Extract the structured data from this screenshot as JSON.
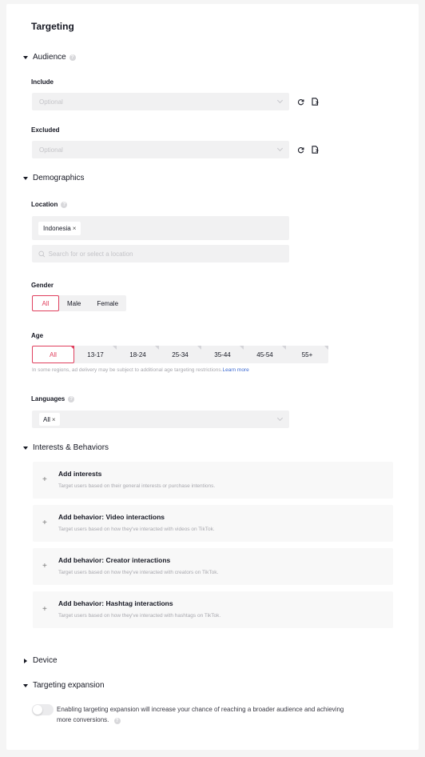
{
  "page": {
    "title": "Targeting"
  },
  "colors": {
    "accent": "#e0405e",
    "link": "#3e6bd1",
    "field_bg": "#f1f1f2"
  },
  "audience": {
    "section_label": "Audience",
    "expanded": true,
    "include": {
      "label": "Include",
      "placeholder": "Optional",
      "actions": [
        "refresh-icon",
        "file-import-icon"
      ]
    },
    "excluded": {
      "label": "Excluded",
      "placeholder": "Optional",
      "actions": [
        "refresh-icon",
        "file-import-icon"
      ]
    }
  },
  "demographics": {
    "section_label": "Demographics",
    "expanded": true,
    "location": {
      "label": "Location",
      "selected": [
        "Indonesia"
      ],
      "remove_glyph": "×",
      "search_placeholder": "Search for or select a location"
    },
    "gender": {
      "label": "Gender",
      "options": [
        "All",
        "Male",
        "Female"
      ],
      "selected": "All"
    },
    "age": {
      "label": "Age",
      "options": [
        "All",
        "13-17",
        "18-24",
        "25-34",
        "35-44",
        "45-54",
        "55+"
      ],
      "selected": "All",
      "hint": "In some regions, ad delivery may be subject to additional age targeting restrictions.",
      "hint_link": "Learn more"
    },
    "languages": {
      "label": "Languages",
      "selected": [
        "All"
      ],
      "remove_glyph": "×"
    }
  },
  "interests_behaviors": {
    "section_label": "Interests & Behaviors",
    "expanded": true,
    "cards": [
      {
        "title": "Add interests",
        "description": "Target users based on their general interests or purchase intentions."
      },
      {
        "title": "Add behavior: Video interactions",
        "description": "Target users based on how they've interacted with videos on TikTok."
      },
      {
        "title": "Add behavior: Creator interactions",
        "description": "Target users based on how they've interacted with creators on TikTok."
      },
      {
        "title": "Add behavior: Hashtag interactions",
        "description": "Target users based on how they've interacted with hashtags on TikTok."
      }
    ],
    "plus_glyph": "+"
  },
  "device": {
    "section_label": "Device",
    "expanded": false
  },
  "targeting_expansion": {
    "section_label": "Targeting expansion",
    "expanded": true,
    "enabled": false,
    "description": "Enabling targeting expansion will increase your chance of reaching a broader audience and achieving more conversions."
  },
  "help_glyph": "?"
}
